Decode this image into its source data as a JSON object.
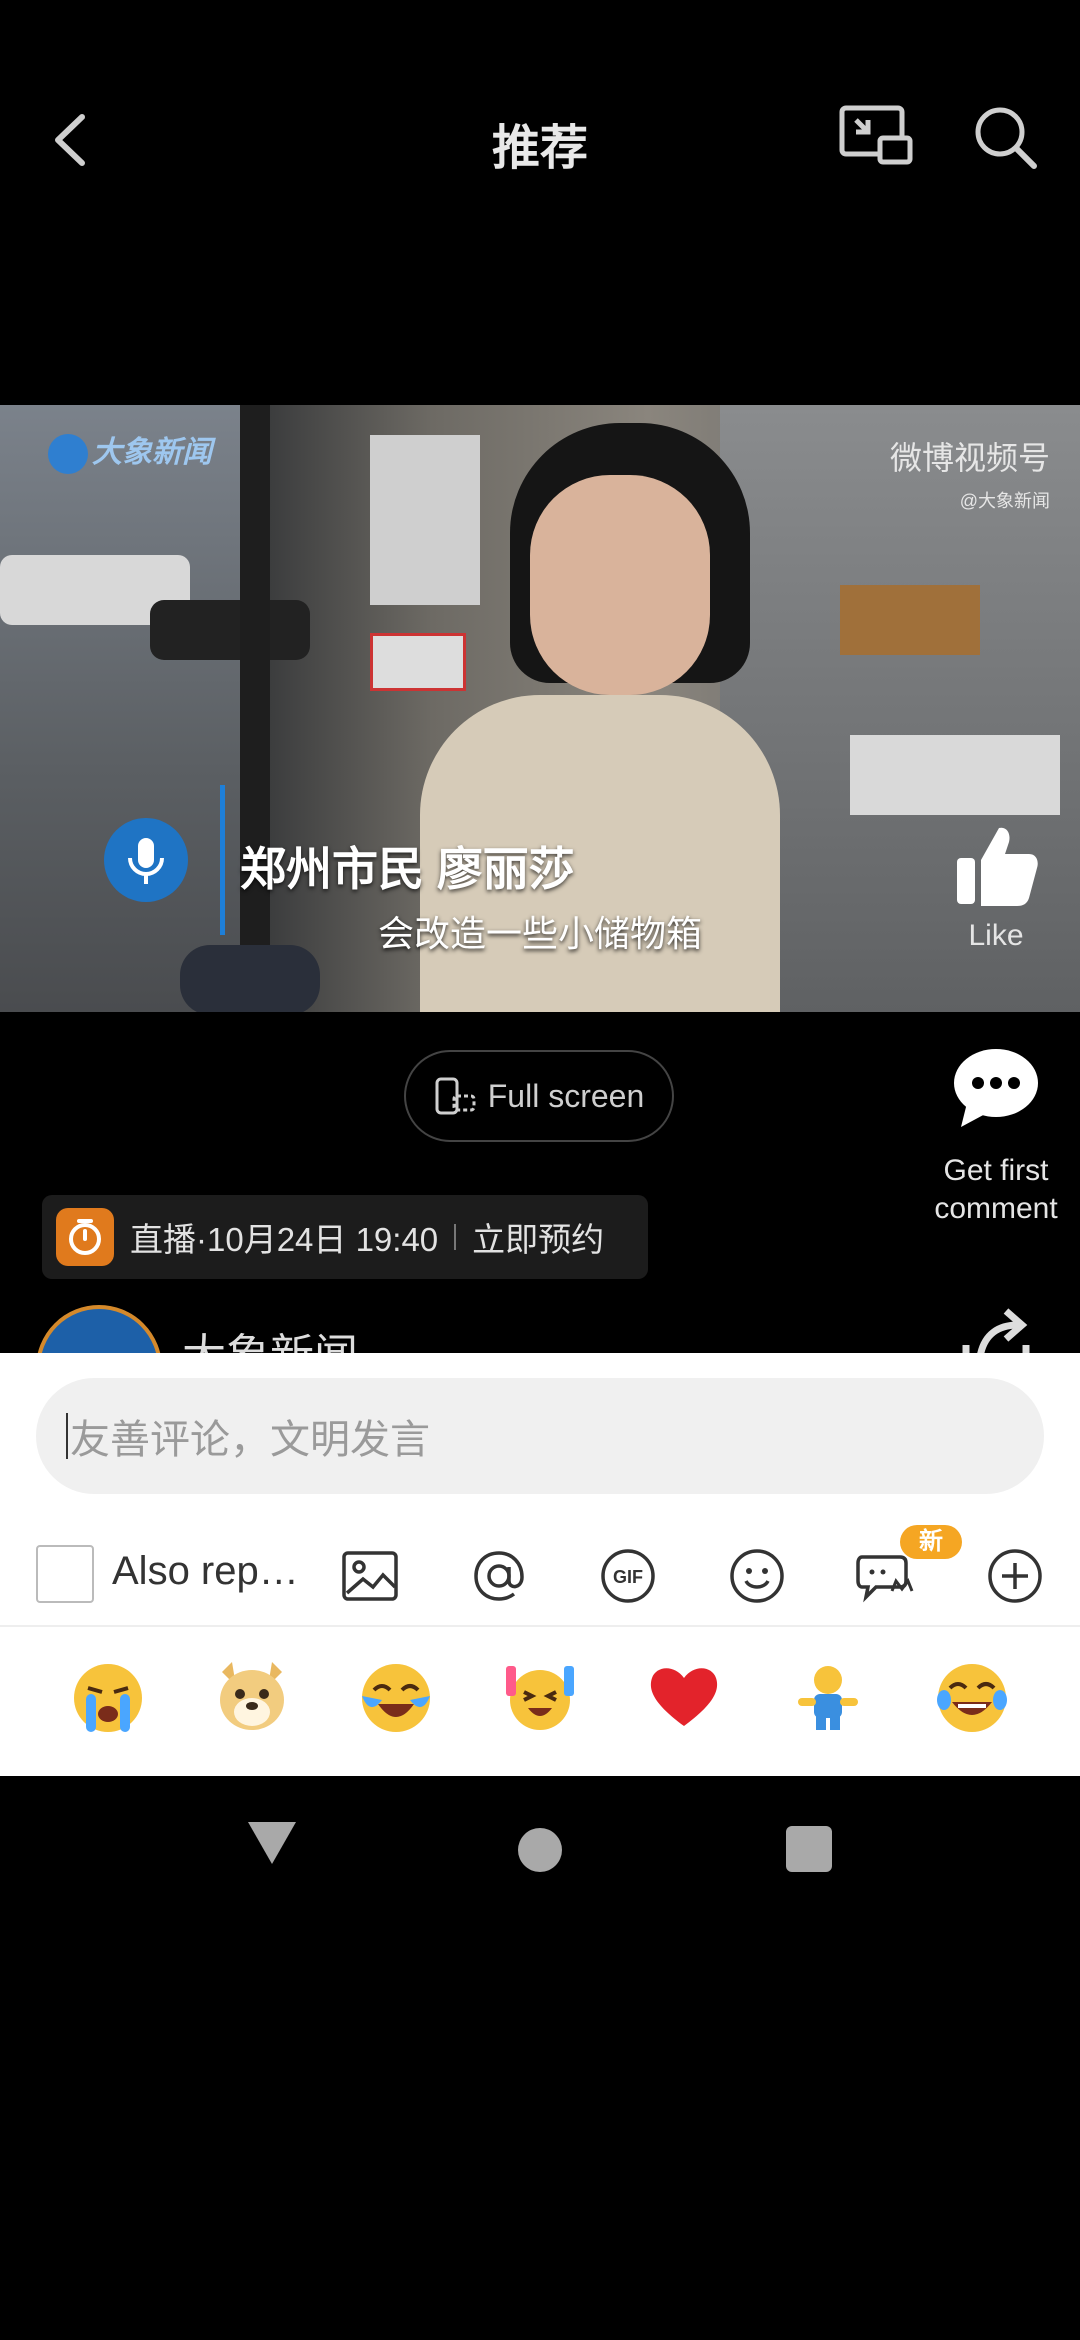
{
  "header": {
    "title": "推荐"
  },
  "video": {
    "brand_logo_text": "大象新闻",
    "watermark_title": "微博视频号",
    "watermark_handle": "@大象新闻",
    "speaker_name": "郑州市民 廖丽莎",
    "subtitle": "会改造一些小储物箱"
  },
  "actions": {
    "like_label": "Like",
    "comment_label": "Get first comment",
    "fullscreen_label": "Full screen"
  },
  "live": {
    "text": "直播·10月24日 19:40",
    "reserve_label": "立即预约"
  },
  "account": {
    "name": "大象新闻"
  },
  "comment_panel": {
    "placeholder": "友善评论，文明发言",
    "repost_label": "Also rep…",
    "new_badge": "新",
    "tools": [
      "image-icon",
      "mention-icon",
      "gif-icon",
      "emoji-icon",
      "super-emoji-icon",
      "add-icon"
    ],
    "emojis": [
      "crying-emoji",
      "doge-emoji",
      "laugh-cry-emoji",
      "cheer-emoji",
      "heart-emoji",
      "figure-emoji",
      "tears-of-joy-emoji"
    ]
  },
  "colors": {
    "accent_orange": "#e07a1d",
    "badge_orange": "#f5a623",
    "mic_blue": "#1f74c4"
  }
}
